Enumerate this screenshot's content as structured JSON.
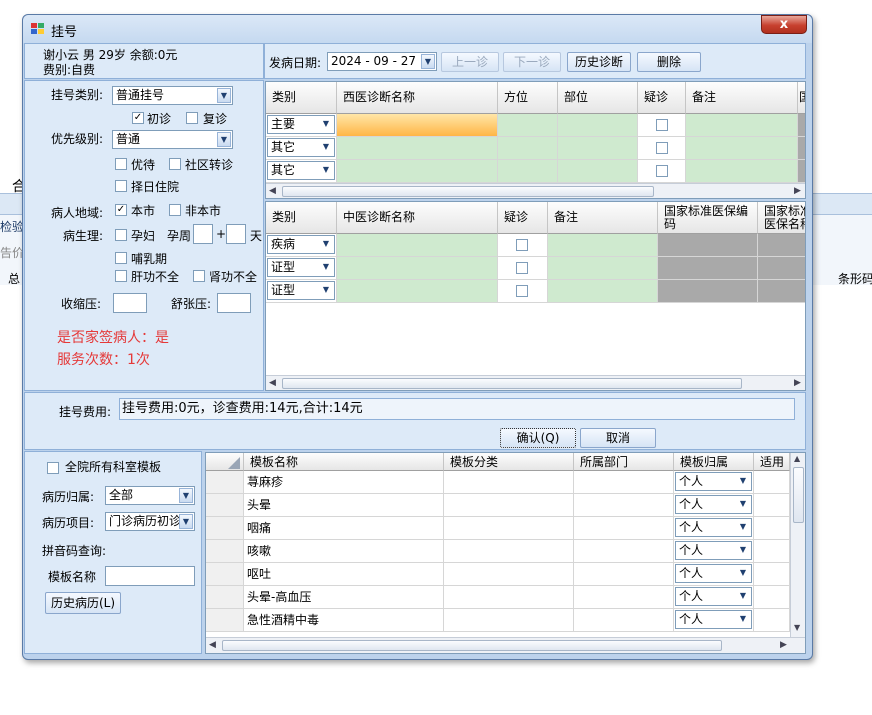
{
  "window": {
    "title": "挂号",
    "close_glyph": "x"
  },
  "background": {
    "char1": "合",
    "char2": "检验",
    "char3": "告价",
    "char4": "总",
    "char5": "条形码"
  },
  "patient": {
    "line1": "谢小云 男 29岁 余额:0元",
    "line2": "费别:自费"
  },
  "left": {
    "reg_type_label": "挂号类别:",
    "reg_type_value": "普通挂号",
    "first_visit": "初诊",
    "revisit": "复诊",
    "priority_label": "优先级别:",
    "priority_value": "普通",
    "preferential": "优待",
    "community_transfer": "社区转诊",
    "select_date": "择日住院",
    "region_label": "病人地域:",
    "local": "本市",
    "nonlocal": "非本市",
    "physio_label": "病生理:",
    "pregnant": "孕妇",
    "week_label": "孕周",
    "plus": "+",
    "day": "天",
    "lactation": "哺乳期",
    "liver": "肝功不全",
    "kidney": "肾功不全",
    "systolic": "收缩压:",
    "diastolic": "舒张压:",
    "family_doctor": "是否家签病人：是",
    "service_count": "服务次数：1次"
  },
  "toolbar": {
    "date_label": "发病日期:",
    "date_value": "2024 - 09 - 27",
    "prev": "上一诊",
    "next": "下一诊",
    "history": "历史诊断",
    "delete": "删除"
  },
  "west": {
    "headers": [
      "类别",
      "西医诊断名称",
      "方位",
      "部位",
      "疑诊",
      "备注",
      "国"
    ],
    "rows": [
      "主要",
      "其它",
      "其它"
    ]
  },
  "tcm": {
    "headers": [
      "类别",
      "中医诊断名称",
      "疑诊",
      "备注",
      "国家标准医保编码",
      "国家标准医保名称"
    ],
    "rows": [
      "疾病",
      "证型",
      "证型"
    ]
  },
  "fee": {
    "label": "挂号费用:",
    "value": "挂号费用:0元，诊查费用:14元,合计:14元"
  },
  "actions": {
    "confirm": "确认(Q)",
    "cancel": "取消"
  },
  "template_panel": {
    "all_label": "全院所有科室模板",
    "owner_label": "病历归属:",
    "owner_value": "全部",
    "item_label": "病历项目:",
    "item_value": "门诊病历初诊",
    "pinyin_label": "拼音码查询:",
    "name_label": "模板名称",
    "history_btn": "历史病历(L)"
  },
  "template_grid": {
    "headers": [
      "模板名称",
      "模板分类",
      "所属部门",
      "模板归属",
      "适用"
    ],
    "rows": [
      {
        "name": "荨麻疹",
        "owner": "个人"
      },
      {
        "name": "头晕",
        "owner": "个人"
      },
      {
        "name": "咽痛",
        "owner": "个人"
      },
      {
        "name": "咳嗽",
        "owner": "个人"
      },
      {
        "name": "呕吐",
        "owner": "个人"
      },
      {
        "name": "头晕-高血压",
        "owner": "个人"
      },
      {
        "name": "急性酒精中毒",
        "owner": "个人"
      }
    ]
  }
}
